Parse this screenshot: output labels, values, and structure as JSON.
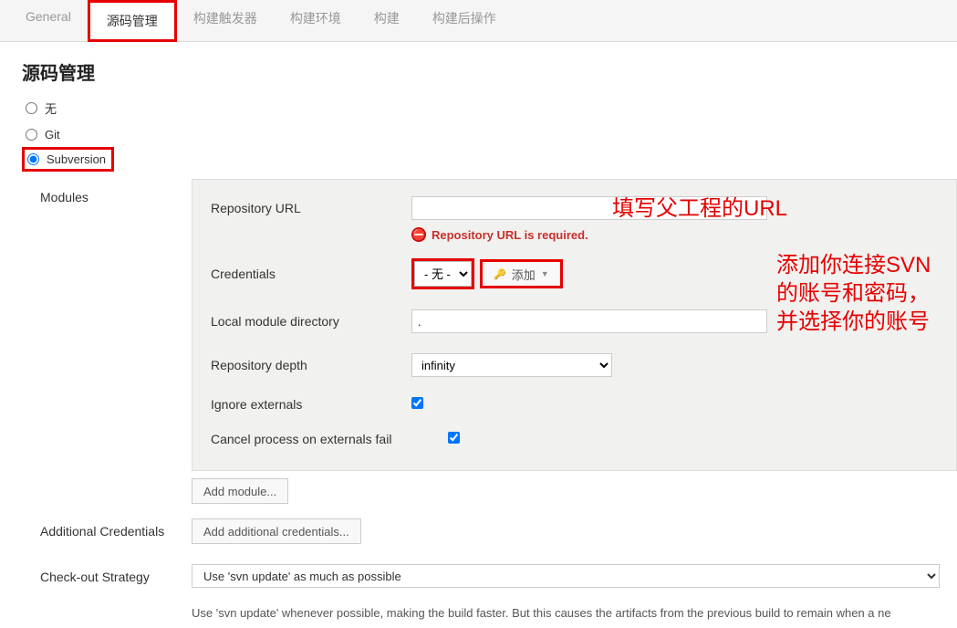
{
  "tabs": [
    "General",
    "源码管理",
    "构建触发器",
    "构建环境",
    "构建",
    "构建后操作"
  ],
  "active_tab": "源码管理",
  "section_title": "源码管理",
  "scm": {
    "options": [
      "无",
      "Git",
      "Subversion"
    ],
    "selected": "Subversion"
  },
  "modules": {
    "label": "Modules",
    "fields": {
      "repo_url_label": "Repository URL",
      "repo_url_value": "",
      "repo_url_error": "Repository URL is required.",
      "credentials_label": "Credentials",
      "credentials_value": "- 无 -",
      "add_button": "添加",
      "local_dir_label": "Local module directory",
      "local_dir_value": ".",
      "depth_label": "Repository depth",
      "depth_value": "infinity",
      "ignore_ext_label": "Ignore externals",
      "ignore_ext_checked": true,
      "cancel_ext_label": "Cancel process on externals fail",
      "cancel_ext_checked": true
    },
    "add_module_btn": "Add module..."
  },
  "additional_credentials": {
    "label": "Additional Credentials",
    "button": "Add additional credentials..."
  },
  "checkout_strategy": {
    "label": "Check-out Strategy",
    "value": "Use 'svn update' as much as possible",
    "help": "Use 'svn update' whenever possible, making the build faster. But this causes the artifacts from the previous build to remain when a ne"
  },
  "annotations": {
    "a1": "填写父工程的URL",
    "a2": "添加你连接SVN的账号和密码，并选择你的账号"
  }
}
